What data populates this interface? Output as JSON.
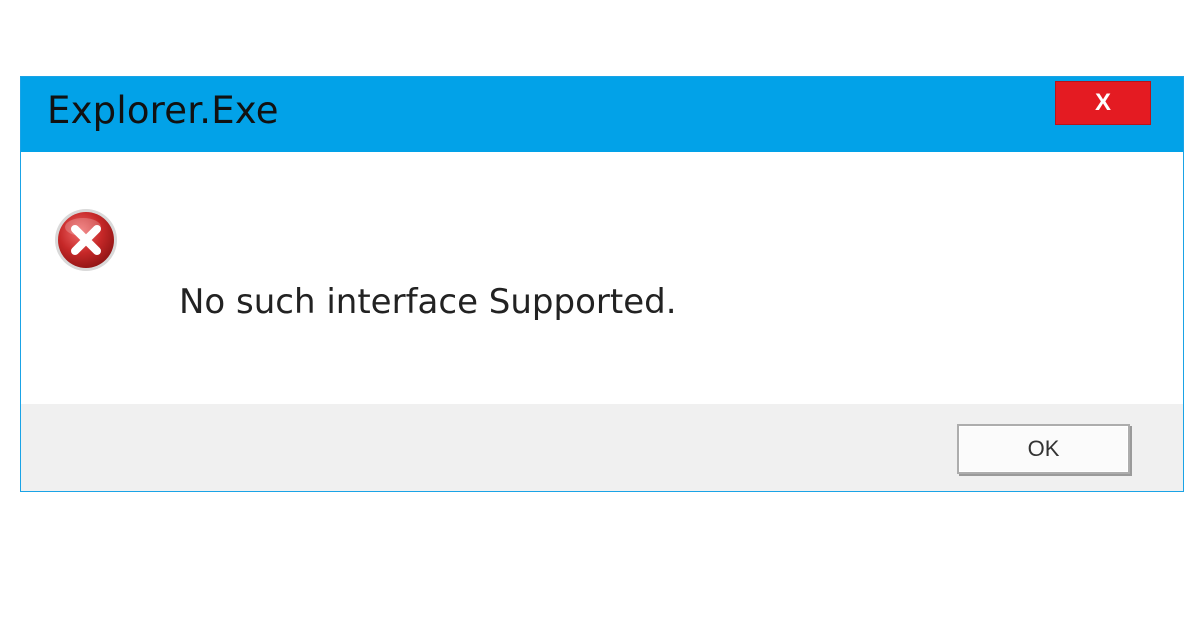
{
  "window": {
    "title": "Explorer.Exe",
    "close_label": "X"
  },
  "dialog": {
    "icon": "error-icon",
    "message": "No such interface Supported.",
    "ok_label": "OK"
  },
  "colors": {
    "titlebar": "#02a2e8",
    "close_button": "#e41b22",
    "footer": "#f0f0f0",
    "error_icon": "#c62828"
  }
}
